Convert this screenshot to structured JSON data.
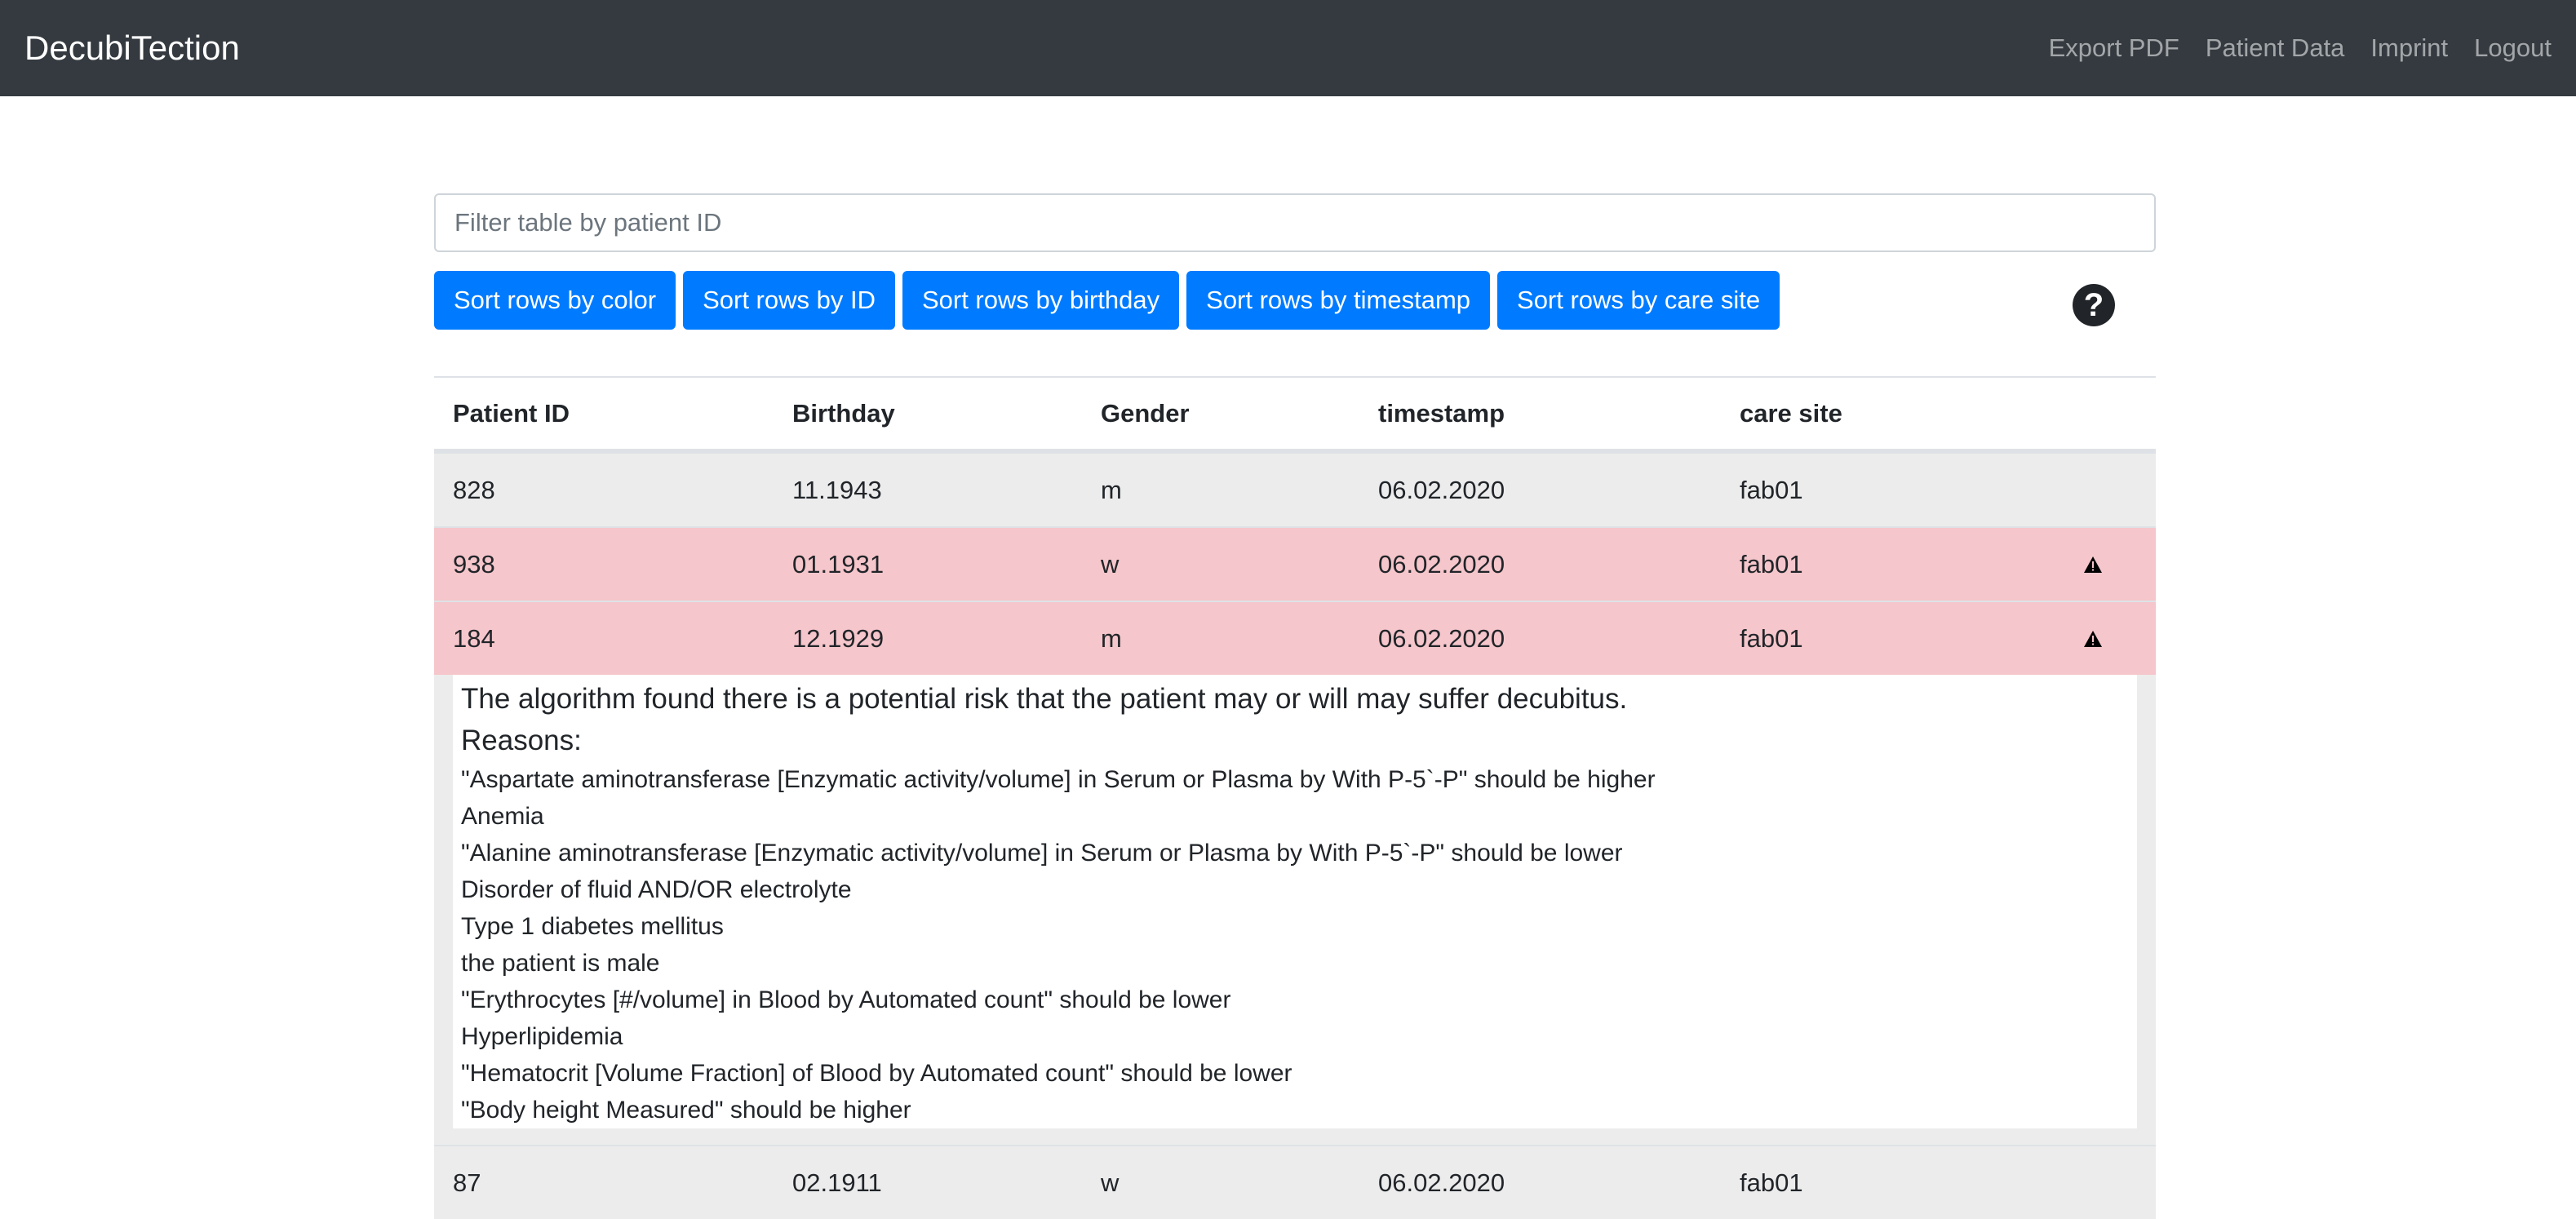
{
  "navbar": {
    "brand": "DecubiTection",
    "links": [
      "Export PDF",
      "Patient Data",
      "Imprint",
      "Logout"
    ]
  },
  "filter": {
    "placeholder": "Filter table by patient ID"
  },
  "buttons": [
    "Sort rows by color",
    "Sort rows by ID",
    "Sort rows by birthday",
    "Sort rows by timestamp",
    "Sort rows by care site"
  ],
  "help_icon": "question-circle-icon",
  "table": {
    "headers": [
      "Patient ID",
      "Birthday",
      "Gender",
      "timestamp",
      "care site"
    ],
    "rows": [
      {
        "id": "828",
        "birthday": "11.1943",
        "gender": "m",
        "timestamp": "06.02.2020",
        "site": "fab01",
        "risk": false
      },
      {
        "id": "938",
        "birthday": "01.1931",
        "gender": "w",
        "timestamp": "06.02.2020",
        "site": "fab01",
        "risk": true
      },
      {
        "id": "184",
        "birthday": "12.1929",
        "gender": "m",
        "timestamp": "06.02.2020",
        "site": "fab01",
        "risk": true
      },
      {
        "id": "87",
        "birthday": "02.1911",
        "gender": "w",
        "timestamp": "06.02.2020",
        "site": "fab01",
        "risk": false
      }
    ]
  },
  "detail": {
    "message": "The algorithm found there is a potential risk that the patient may or will may suffer decubitus.",
    "reasons_label": "Reasons:",
    "reasons": [
      "\"Aspartate aminotransferase [Enzymatic activity/volume] in Serum or Plasma by With P-5`-P\" should be higher",
      "Anemia",
      "\"Alanine aminotransferase [Enzymatic activity/volume] in Serum or Plasma by With P-5`-P\" should be lower",
      "Disorder of fluid AND/OR electrolyte",
      "Type 1 diabetes mellitus",
      "the patient is male",
      "\"Erythrocytes [#/volume] in Blood by Automated count\" should be lower",
      "Hyperlipidemia",
      "\"Hematocrit [Volume Fraction] of Blood by Automated count\" should be lower",
      "\"Body height Measured\" should be higher"
    ]
  },
  "colors": {
    "navbar": "#343a40",
    "primary": "#007bff",
    "risk_row": "#f5c6cb",
    "normal_row": "#ececec"
  }
}
